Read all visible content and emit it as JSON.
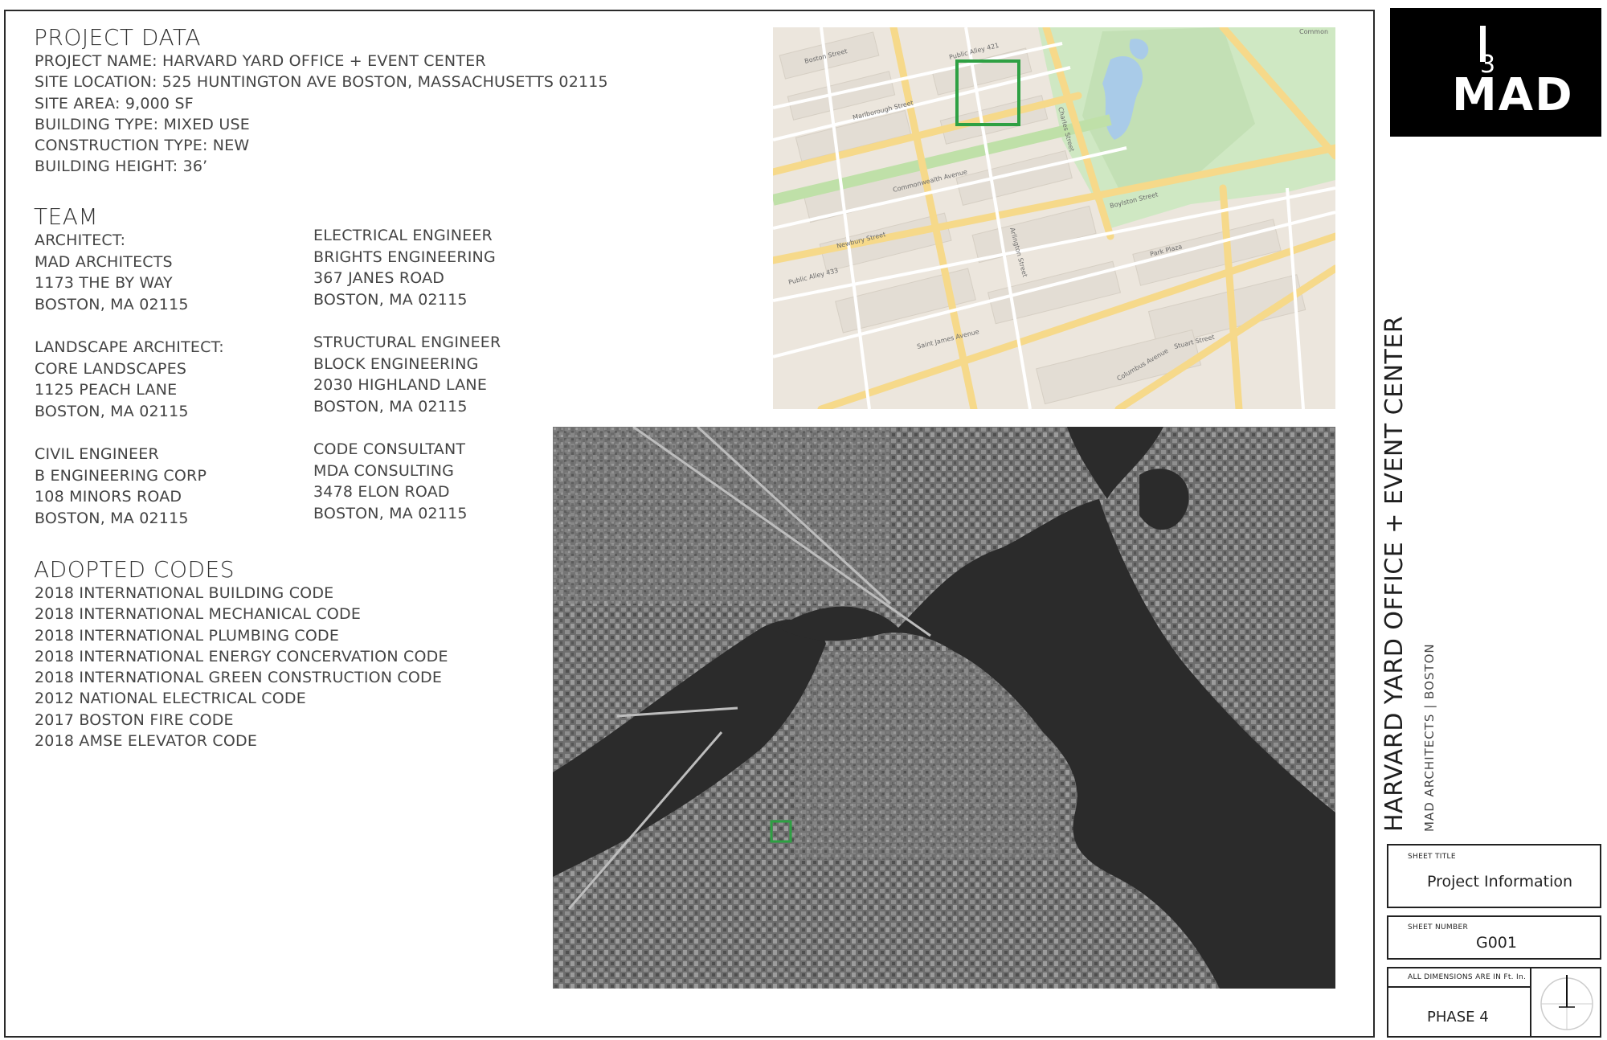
{
  "project_data": {
    "title": "PROJECT DATA",
    "lines": [
      "PROJECT NAME: HARVARD YARD OFFICE + EVENT CENTER",
      "SITE LOCATION: 525 HUNTINGTON AVE BOSTON, MASSACHUSETTS 02115",
      "SITE AREA: 9,000 SF",
      "BUILDING TYPE: MIXED USE",
      "CONSTRUCTION TYPE: NEW",
      "BUILDING HEIGHT: 36’"
    ]
  },
  "team": {
    "title": "TEAM",
    "architect": [
      "ARCHITECT:",
      "MAD ARCHITECTS",
      "1173 THE BY WAY",
      "BOSTON, MA 02115"
    ],
    "landscape": [
      "LANDSCAPE ARCHITECT:",
      "CORE LANDSCAPES",
      "1125 PEACH LANE",
      "BOSTON, MA 02115"
    ],
    "civil": [
      "CIVIL ENGINEER",
      "B ENGINEERING CORP",
      "108 MINORS ROAD",
      "BOSTON, MA 02115"
    ],
    "electrical": [
      "ELECTRICAL ENGINEER",
      "BRIGHTS ENGINEERING",
      "367 JANES ROAD",
      "BOSTON, MA 02115"
    ],
    "structural": [
      "STRUCTURAL ENGINEER",
      "BLOCK ENGINEERING",
      "2030 HIGHLAND LANE",
      "BOSTON, MA 02115"
    ],
    "code": [
      "CODE CONSULTANT",
      "MDA CONSULTING",
      "3478 ELON ROAD",
      "BOSTON, MA 02115"
    ]
  },
  "codes": {
    "title": "ADOPTED CODES",
    "items": [
      "2018 INTERNATIONAL BUILDING CODE",
      "2018 INTERNATIONAL MECHANICAL CODE",
      "2018 INTERNATIONAL PLUMBING CODE",
      "2018 INTERNATIONAL ENERGY CONCERVATION CODE",
      "2018 INTERNATIONAL GREEN CONSTRUCTION CODE",
      "2012 NATIONAL ELECTRICAL CODE",
      "2017 BOSTON FIRE CODE",
      "2018 AMSE ELEVATOR CODE"
    ]
  },
  "map": {
    "labels": [
      "Boston Street",
      "Marlborough Street",
      "Commonwealth Avenue",
      "Newbury Street",
      "Boylston Street",
      "Saint James Avenue",
      "Stuart Street",
      "Park Plaza",
      "Columbus Avenue",
      "Charles Street",
      "Arlington Street",
      "Public Alley 421",
      "Public Alley 433",
      "Common"
    ],
    "marker_color": "#2ea043"
  },
  "title_block": {
    "logo_text": "MAD",
    "logo_mark": "3",
    "project_title": "HARVARD YARD OFFICE + EVENT CENTER",
    "firm": "MAD ARCHITECTS",
    "city": "BOSTON",
    "sheet_title_label": "SHEET TITLE",
    "sheet_title": "Project Information",
    "sheet_number_label": "SHEET NUMBER",
    "sheet_number": "G001",
    "dimensions_note": "ALL DIMENSIONS ARE IN Ft. In.",
    "phase": "PHASE 4"
  }
}
